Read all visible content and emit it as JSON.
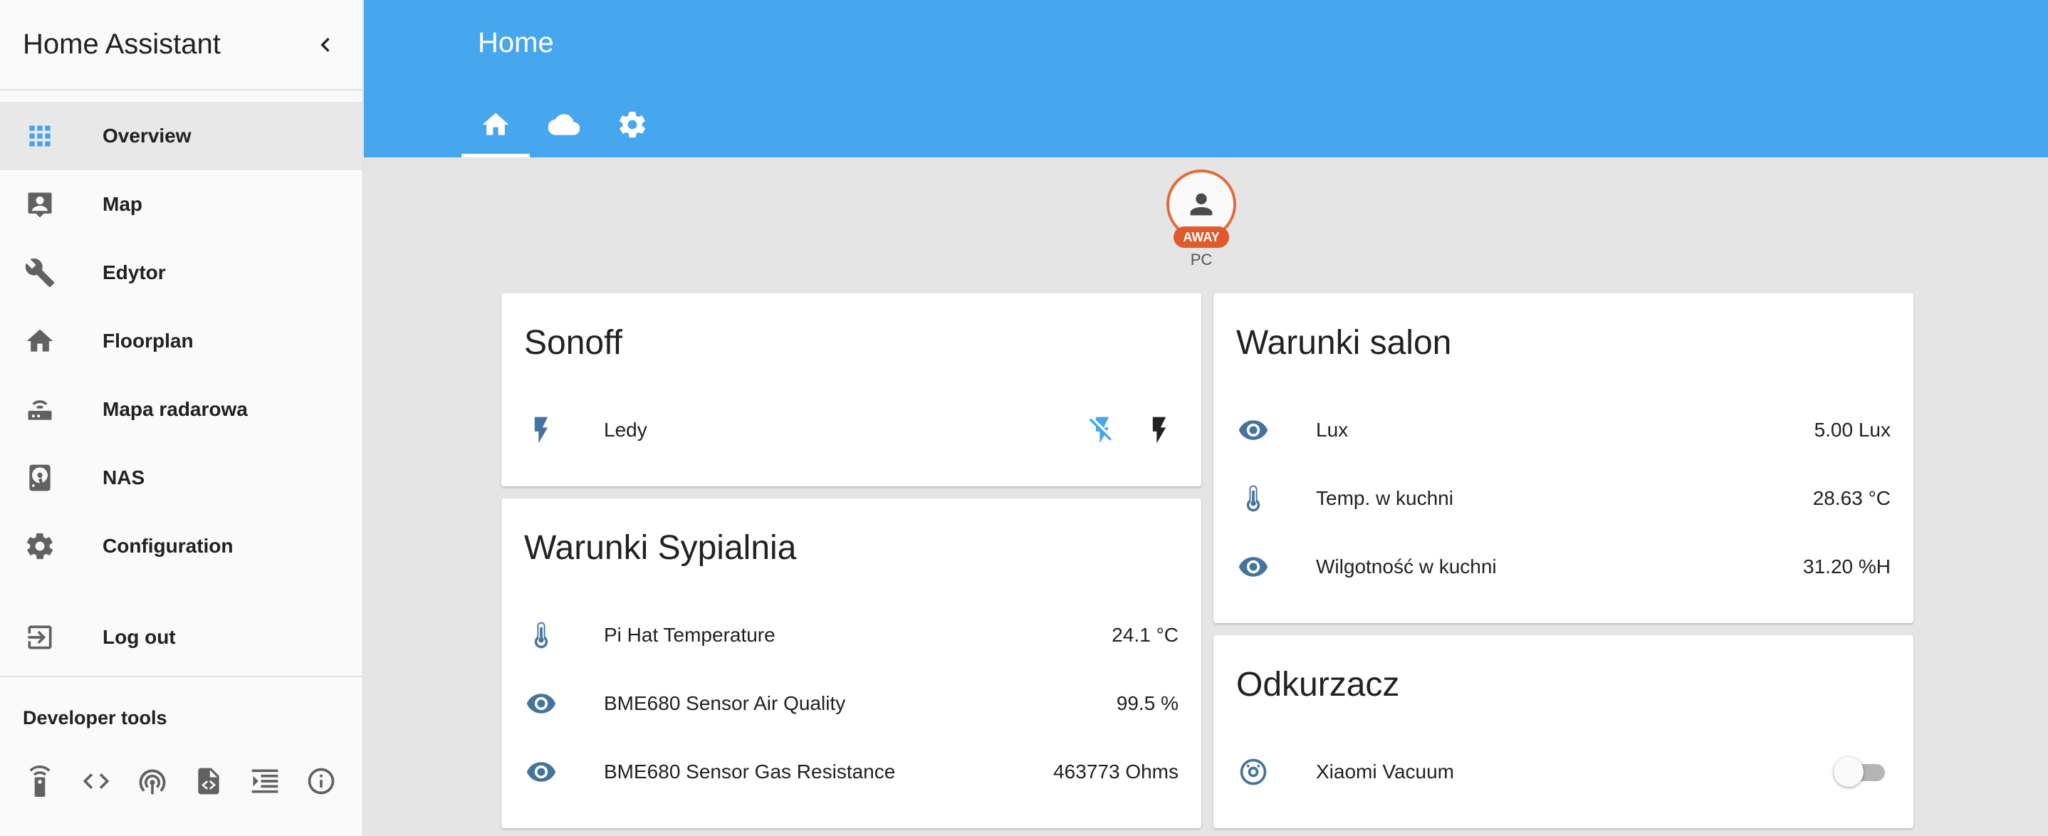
{
  "sidebar": {
    "title": "Home Assistant",
    "items": [
      {
        "label": "Overview",
        "icon": "grid-icon"
      },
      {
        "label": "Map",
        "icon": "account-box-icon"
      },
      {
        "label": "Edytor",
        "icon": "wrench-icon"
      },
      {
        "label": "Floorplan",
        "icon": "home-icon"
      },
      {
        "label": "Mapa radarowa",
        "icon": "router-icon"
      },
      {
        "label": "NAS",
        "icon": "harddisk-icon"
      },
      {
        "label": "Configuration",
        "icon": "gear-icon"
      }
    ],
    "logout_label": "Log out",
    "developer_tools_title": "Developer tools"
  },
  "header": {
    "title": "Home",
    "tabs": [
      "home-icon",
      "cloud-icon",
      "gear-icon"
    ]
  },
  "badge": {
    "state": "AWAY",
    "name": "PC"
  },
  "cards": {
    "sonoff": {
      "title": "Sonoff",
      "rows": [
        {
          "label": "Ledy",
          "icon": "flash-icon"
        }
      ]
    },
    "warunki_sypialnia": {
      "title": "Warunki Sypialnia",
      "rows": [
        {
          "label": "Pi Hat Temperature",
          "value": "24.1 °C",
          "icon": "thermometer-icon"
        },
        {
          "label": "BME680 Sensor Air Quality",
          "value": "99.5 %",
          "icon": "eye-icon"
        },
        {
          "label": "BME680 Sensor Gas Resistance",
          "value": "463773 Ohms",
          "icon": "eye-icon"
        }
      ]
    },
    "warunki_salon": {
      "title": "Warunki salon",
      "rows": [
        {
          "label": "Lux",
          "value": "5.00 Lux",
          "icon": "eye-icon"
        },
        {
          "label": "Temp. w kuchni",
          "value": "28.63 °C",
          "icon": "thermometer-icon"
        },
        {
          "label": "Wilgotność w kuchni",
          "value": "31.20 %H",
          "icon": "eye-icon"
        }
      ]
    },
    "odkurzacz": {
      "title": "Odkurzacz",
      "rows": [
        {
          "label": "Xiaomi Vacuum",
          "icon": "robot-vacuum-icon",
          "state": "off"
        }
      ]
    }
  },
  "colors": {
    "header": "#46a6ee",
    "sidebar_active_icon": "#46a4ed",
    "state_icon": "#44739e",
    "badge_border": "#e46a40",
    "flash_off_button": "#46a6ee"
  }
}
